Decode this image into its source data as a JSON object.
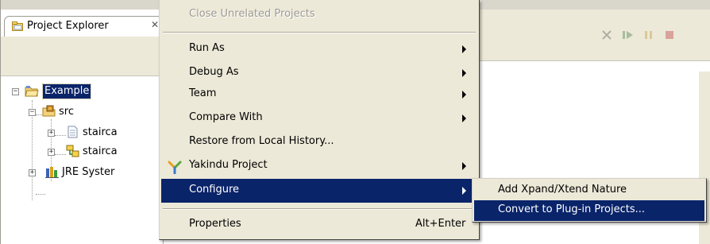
{
  "explorer": {
    "tab_title": "Project Explorer",
    "tab_close_glyph": "✕",
    "tree": {
      "project": {
        "label": "Example",
        "expander": "−"
      },
      "src": {
        "label": "src",
        "expander": "−"
      },
      "file1": {
        "label": "stairca",
        "expander": "+"
      },
      "file2": {
        "label": "stairca",
        "expander": "+"
      },
      "jre": {
        "label": "JRE Syster",
        "expander": "+"
      }
    }
  },
  "context_menu": {
    "items": [
      {
        "label": "Close Unrelated Projects",
        "disabled": true
      },
      {
        "label": "Run As",
        "submenu": true
      },
      {
        "label": "Debug As",
        "submenu": true
      },
      {
        "label": "Team",
        "submenu": true
      },
      {
        "label": "Compare With",
        "submenu": true
      },
      {
        "label": "Restore from Local History..."
      },
      {
        "label": "Yakindu Project",
        "submenu": true,
        "icon": "yakindu-icon"
      },
      {
        "label": "Configure",
        "submenu": true,
        "highlighted": true
      },
      {
        "label": "Properties",
        "accelerator": "Alt+Enter"
      }
    ]
  },
  "submenu": {
    "items": [
      {
        "label": "Add Xpand/Xtend Nature"
      },
      {
        "label": "Convert to Plug-in Projects...",
        "highlighted": true
      }
    ]
  },
  "colors": {
    "selection": "#0a246a",
    "menu_background": "#ece9d8",
    "disabled_text": "#9d9b93"
  }
}
